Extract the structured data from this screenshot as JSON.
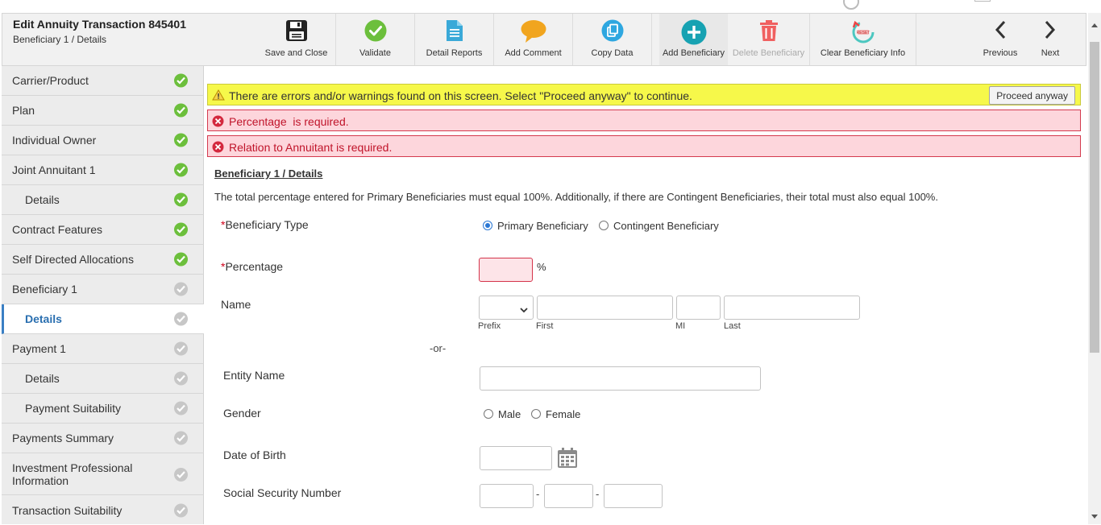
{
  "header": {
    "title": "Edit Annuity Transaction 845401",
    "subtitle": "Beneficiary 1 / Details"
  },
  "toolbar": {
    "save_close": "Save and Close",
    "validate": "Validate",
    "detail_reports": "Detail Reports",
    "add_comment": "Add Comment",
    "copy_data": "Copy Data",
    "add_beneficiary": "Add Beneficiary",
    "delete_beneficiary": "Delete Beneficiary",
    "clear_beneficiary": "Clear Beneficiary Info",
    "previous": "Previous",
    "next": "Next"
  },
  "sidebar": {
    "items": [
      {
        "label": "Carrier/Product",
        "status": "complete"
      },
      {
        "label": "Plan",
        "status": "complete"
      },
      {
        "label": "Individual Owner",
        "status": "complete"
      },
      {
        "label": "Joint Annuitant 1",
        "status": "complete"
      },
      {
        "label": "Details",
        "status": "complete"
      },
      {
        "label": "Contract Features",
        "status": "complete"
      },
      {
        "label": "Self Directed Allocations",
        "status": "complete"
      },
      {
        "label": "Beneficiary 1",
        "status": "incomplete"
      },
      {
        "label": "Details",
        "status": "incomplete"
      },
      {
        "label": "Payment 1",
        "status": "incomplete"
      },
      {
        "label": "Details",
        "status": "incomplete"
      },
      {
        "label": "Payment Suitability",
        "status": "incomplete"
      },
      {
        "label": "Payments Summary",
        "status": "incomplete"
      },
      {
        "label": "Investment Professional Information",
        "status": "incomplete"
      },
      {
        "label": "Transaction Suitability",
        "status": "incomplete"
      }
    ]
  },
  "alerts": {
    "warning": "There are errors and/or warnings found on this screen. Select \"Proceed anyway\" to continue.",
    "proceed_label": "Proceed anyway",
    "errors": [
      "Percentage  is required.",
      "Relation to Annuitant is required."
    ]
  },
  "form": {
    "section_title": "Beneficiary 1 / Details",
    "info": "The total percentage entered for Primary Beneficiaries must equal 100%. Additionally, if there are Contingent Beneficiaries, their total must also equal 100%.",
    "required_mark": "*",
    "beneficiary_type_label": "Beneficiary Type",
    "primary_label": "Primary Beneficiary",
    "contingent_label": "Contingent Beneficiary",
    "percentage_label": "Percentage",
    "percent_sign": "%",
    "percentage_value": "",
    "name_label": "Name",
    "prefix_label": "Prefix",
    "first_label": "First",
    "mi_label": "MI",
    "last_label": "Last",
    "or_text": "-or-",
    "entity_label": "Entity Name",
    "gender_label": "Gender",
    "male_label": "Male",
    "female_label": "Female",
    "dob_label": "Date of Birth",
    "ssn_label": "Social Security Number",
    "ssn_dash": "-"
  },
  "colors": {
    "complete": "#6cbf3c",
    "incomplete": "#c7c7c7",
    "warning_bg": "#f6f84a",
    "error_bg": "#fdd6dc",
    "error_text": "#c0142a",
    "active_text": "#2a6fb0"
  },
  "icons": {
    "save": "save-disk-icon",
    "validate": "check-circle-icon",
    "reports": "document-icon",
    "comment": "speech-bubble-icon",
    "copy": "copy-icon",
    "add": "plus-circle-icon",
    "delete": "trash-icon",
    "clear": "reset-icon",
    "previous": "chevron-left-icon",
    "next": "chevron-right-icon",
    "calendar": "calendar-icon"
  }
}
